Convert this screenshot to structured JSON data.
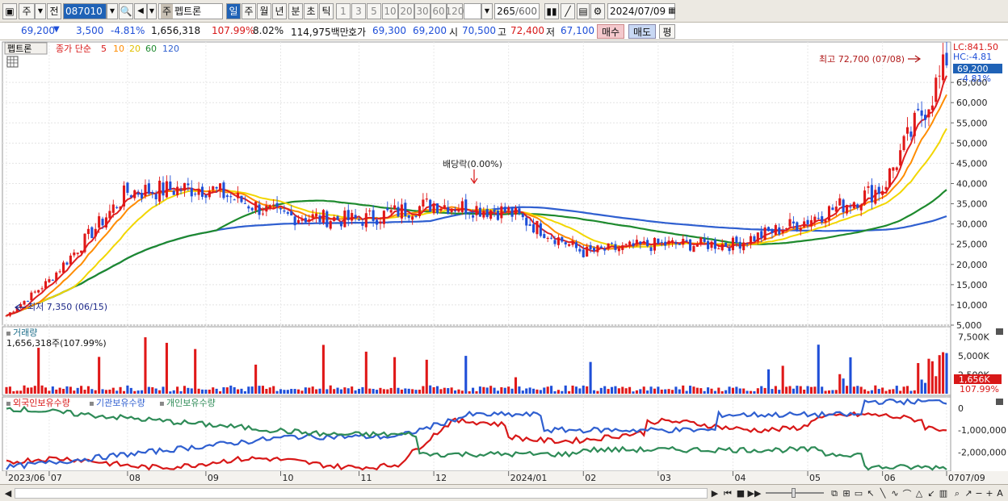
{
  "toolbar": {
    "market": "주",
    "prev_btn": "전",
    "code": "087010",
    "name_type": "주",
    "name": "펩트론",
    "periods": [
      "일",
      "주",
      "월",
      "년",
      "분",
      "초",
      "틱"
    ],
    "active_period": "일",
    "multipliers": [
      "1",
      "3",
      "5",
      "10",
      "20",
      "30",
      "60",
      "120"
    ],
    "count": "265",
    "max_count": "/600",
    "date": "2024/07/09"
  },
  "ticker": {
    "price": "69,200",
    "change": "3,500",
    "rate": "-4.81%",
    "volume": "1,656,318",
    "vol_ratio": "107.99%",
    "turnover": "8.02%",
    "amount": "114,975백만",
    "quote_label": "호가",
    "ask": "69,300",
    "bid": "69,200",
    "open_label": "시",
    "open": "70,500",
    "high_label": "고",
    "high": "72,400",
    "low_label": "저",
    "low": "67,100",
    "buy": "매수",
    "sell": "매도",
    "avg": "평"
  },
  "price_panel": {
    "name": "펩트론",
    "ma_label": "종가 단순",
    "ma_periods": [
      "5",
      "10",
      "20",
      "60",
      "120"
    ],
    "ma_colors": [
      "#e02020",
      "#ff8c00",
      "#f2d600",
      "#1e8a2e",
      "#2f5fd0"
    ],
    "lc": "LC:841.50",
    "hc": "HC:-4.81",
    "current": "69,200",
    "current_rate": "-4.81%",
    "high_annot": "최고 72,700 (07/08)",
    "low_annot": "최저 7,350 (06/15)",
    "event_annot": "배당락(0.00%)",
    "y_ticks": [
      "65,000",
      "60,000",
      "55,000",
      "50,000",
      "45,000",
      "40,000",
      "35,000",
      "30,000",
      "25,000",
      "20,000",
      "15,000",
      "10,000",
      "5,000"
    ]
  },
  "volume_panel": {
    "title": "거래량",
    "value": "1,656,318주(107.99%)",
    "y_ticks": [
      "7,500K",
      "5,000K",
      "2,500K"
    ],
    "current": "1,656K",
    "current_rate": "107.99%"
  },
  "holder_panel": {
    "series": [
      {
        "name": "외국인보유수량",
        "color": "#d81818"
      },
      {
        "name": "기관보유수량",
        "color": "#2f5fd0"
      },
      {
        "name": "개인보유수량",
        "color": "#2e8b57"
      }
    ],
    "y_ticks": [
      "0",
      "-1,000,000",
      "-2,000,000"
    ]
  },
  "x_axis": {
    "labels": [
      "2023/06",
      "07",
      "08",
      "09",
      "10",
      "11",
      "12",
      "2024/01",
      "02",
      "03",
      "04",
      "05",
      "06",
      "07"
    ],
    "right_label": "07/09"
  },
  "chart_data": {
    "type": "candlestick",
    "x_range": [
      "2023/06",
      "2024/07/09"
    ],
    "ylim": [
      5000,
      75000
    ],
    "series_approx": {
      "close_monthly": [
        {
          "x": "2023/06",
          "y": 7350
        },
        {
          "x": "2023/07",
          "y": 16000
        },
        {
          "x": "2023/08",
          "y": 38000
        },
        {
          "x": "2023/09",
          "y": 39000
        },
        {
          "x": "2023/10",
          "y": 32000
        },
        {
          "x": "2023/11",
          "y": 31000
        },
        {
          "x": "2023/12",
          "y": 35000
        },
        {
          "x": "2024/01",
          "y": 33000
        },
        {
          "x": "2024/02",
          "y": 23000
        },
        {
          "x": "2024/03",
          "y": 25000
        },
        {
          "x": "2024/04",
          "y": 25000
        },
        {
          "x": "2024/05",
          "y": 31000
        },
        {
          "x": "2024/06",
          "y": 39000
        },
        {
          "x": "2024/07/09",
          "y": 69200
        }
      ]
    },
    "volume_ylim": [
      0,
      8500
    ],
    "volume_unit": "K",
    "holder_ylim": [
      -2800000,
      400000
    ]
  },
  "status": {
    "buttons": [
      "▶",
      "⏮",
      "■",
      "▶▶"
    ]
  }
}
